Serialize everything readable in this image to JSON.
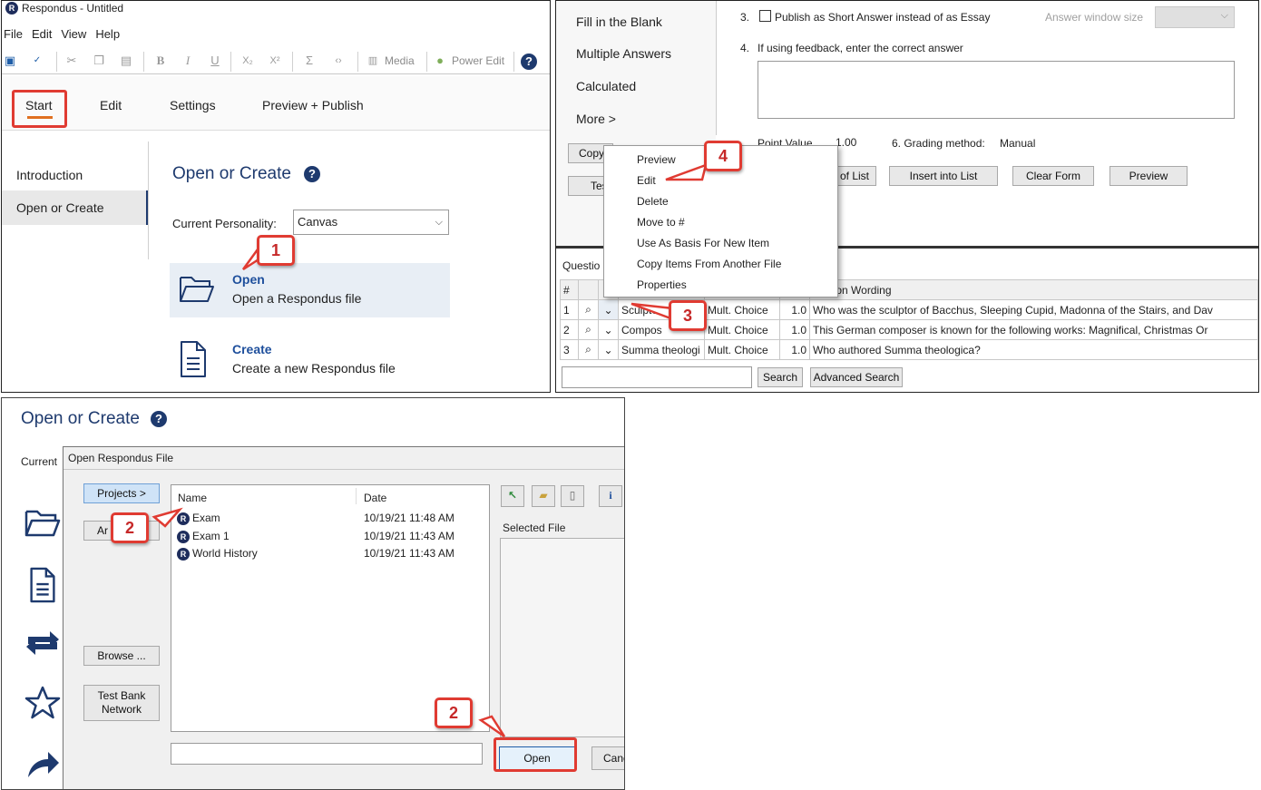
{
  "panel1": {
    "window_title": "Respondus - Untitled",
    "logo": "R",
    "menu": [
      "File",
      "Edit",
      "View",
      "Help"
    ],
    "toolbar": {
      "media": "Media",
      "power_edit": "Power Edit",
      "help": "?"
    },
    "tabs": [
      "Start",
      "Edit",
      "Settings",
      "Preview + Publish"
    ],
    "sidebar": [
      "Introduction",
      "Open or Create"
    ],
    "heading": "Open or Create",
    "personality_label": "Current Personality:",
    "personality_value": "Canvas",
    "open_title": "Open",
    "open_desc": "Open a Respondus file",
    "create_title": "Create",
    "create_desc": "Create a new Respondus file"
  },
  "panel2": {
    "question_types": [
      "Fill in the Blank",
      "Multiple Answers",
      "Calculated",
      "More >"
    ],
    "step3_num": "3.",
    "step3_text": "Publish as Short Answer instead of as Essay",
    "answer_window_label": "Answer window size",
    "step4_num": "4.",
    "step4_text": "If using feedback, enter the correct answer",
    "point_value_label": "Point Value",
    "point_value": "1.00",
    "grading_label": "6.  Grading method:",
    "grading_value": "Manual",
    "buttons": [
      "of List",
      "Insert into List",
      "Clear Form",
      "Preview"
    ],
    "left_buttons": [
      "Copy",
      "Tes"
    ],
    "context_menu": [
      "Preview",
      "Edit",
      "Delete",
      "Move to #",
      "Use As Basis For New Item",
      "Copy Items From Another File",
      "Properties"
    ],
    "questions_label": "Questio",
    "table_header": {
      "num": "#",
      "wording": "uestion Wording"
    },
    "rows": [
      {
        "num": "1",
        "title": "Sculptor",
        "type": "Mult. Choice",
        "points": "1.0",
        "wording": "Who was the sculptor of Bacchus, Sleeping Cupid, Madonna of the Stairs, and Dav"
      },
      {
        "num": "2",
        "title": "Compos",
        "type": "Mult. Choice",
        "points": "1.0",
        "wording": "This German composer is known for the following works: Magnifical, Christmas Or"
      },
      {
        "num": "3",
        "title": "Summa theologi",
        "type": "Mult. Choice",
        "points": "1.0",
        "wording": "Who authored Summa theologica?"
      }
    ],
    "search_button": "Search",
    "advanced_search_button": "Advanced Search"
  },
  "panel3": {
    "heading": "Open or Create",
    "current_label": "Current",
    "dialog_title": "Open Respondus File",
    "projects_button": "Projects >",
    "ar_button": "Ar",
    "browse_button": "Browse ...",
    "test_bank_button": "Test Bank Network",
    "col_name": "Name",
    "col_date": "Date",
    "files": [
      {
        "name": "Exam",
        "date": "10/19/21  11:48 AM"
      },
      {
        "name": "Exam 1",
        "date": "10/19/21  11:43 AM"
      },
      {
        "name": "World History",
        "date": "10/19/21  11:43 AM"
      }
    ],
    "selected_file_label": "Selected File",
    "info_button": "i",
    "open_button": "Open",
    "cancel_button": "Canc"
  },
  "callouts": [
    "1",
    "2",
    "3",
    "4",
    "2"
  ],
  "colors": {
    "callout_red": "#e03b32",
    "accent_navy": "#1e3a6e",
    "link_blue": "#1e4f9c",
    "tab_underline": "#e07020"
  }
}
